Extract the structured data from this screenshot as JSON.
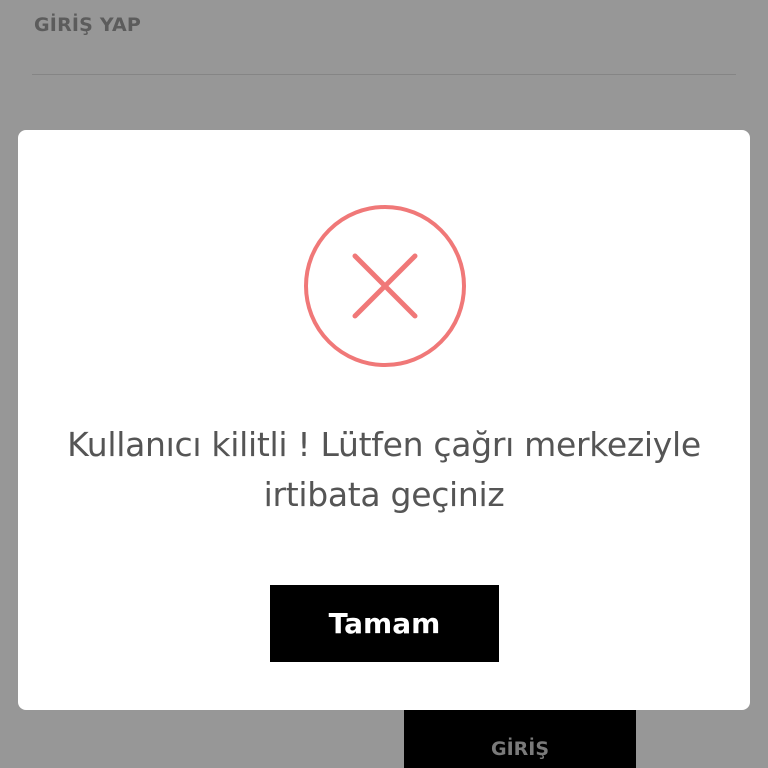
{
  "header": {
    "title": "GİRİŞ YAP"
  },
  "background": {
    "login_button_label": "GİRİŞ"
  },
  "modal": {
    "icon": "error-x-circle-icon",
    "icon_color": "#f07878",
    "message": "Kullanıcı kilitli ! Lütfen çağrı merkeziyle irtibata geçiniz",
    "ok_button_label": "Tamam"
  },
  "colors": {
    "overlay": "#979797",
    "modal_bg": "#ffffff",
    "button_bg": "#000000",
    "text": "#555555"
  }
}
